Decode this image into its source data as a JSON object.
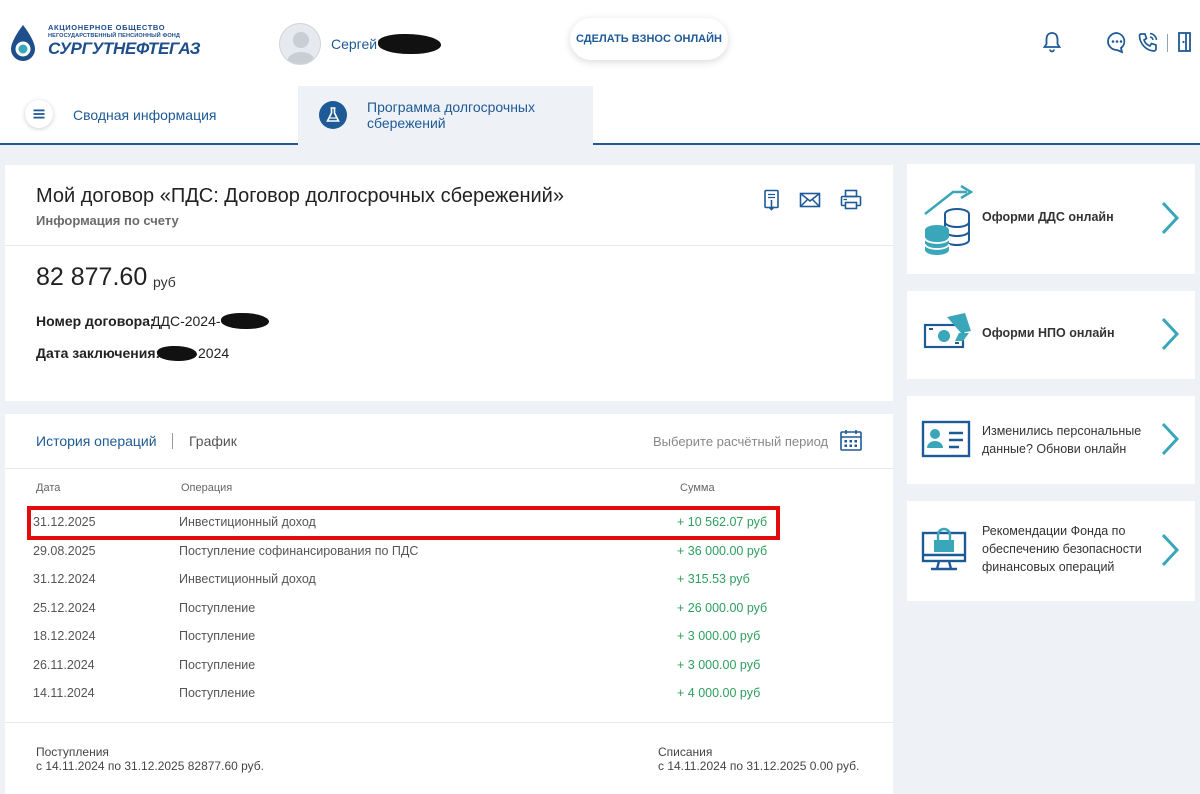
{
  "header": {
    "logo": {
      "line1": "АКЦИОНЕРНОЕ ОБЩЕСТВО",
      "line2": "НЕГОСУДАРСТВЕННЫЙ ПЕНСИОННЫЙ ФОНД",
      "line3": "СУРГУТНЕФТЕГАЗ"
    },
    "user_name": "Сергей",
    "contribute_button": "СДЕЛАТЬ ВЗНОС ОНЛАЙН",
    "icons": [
      "bell-icon",
      "chat-icon",
      "phone-icon",
      "logout-icon"
    ]
  },
  "tabs": [
    {
      "label": "Сводная информация",
      "icon": "menu-icon"
    },
    {
      "label": "Программа долгосрочных сбережений",
      "icon": "flask-icon",
      "active": true
    }
  ],
  "contract": {
    "title": "Мой договор «ПДС: Договор долгосрочных сбережений»",
    "subtitle": "Информация по счету",
    "actions": [
      "document-download-icon",
      "mail-icon",
      "printer-icon"
    ],
    "balance": "82 877.60",
    "balance_unit": "руб",
    "number_label": "Номер договора:",
    "number_value": "ДДС-2024-",
    "date_label": "Дата заключения:",
    "date_value": "2024"
  },
  "history": {
    "tab_active": "История операций",
    "tab_other": "График",
    "period_label": "Выберите расчётный период",
    "columns": [
      "Дата",
      "Операция",
      "Сумма"
    ],
    "rows": [
      {
        "date": "31.12.2025",
        "operation": "Инвестиционный доход",
        "amount": "+ 10 562.07 руб",
        "highlighted": true
      },
      {
        "date": "29.08.2025",
        "operation": "Поступление софинансирования по ПДС",
        "amount": "+ 36 000.00 руб"
      },
      {
        "date": "31.12.2024",
        "operation": "Инвестиционный доход",
        "amount": "+ 315.53 руб"
      },
      {
        "date": "25.12.2024",
        "operation": "Поступление",
        "amount": "+ 26 000.00 руб"
      },
      {
        "date": "18.12.2024",
        "operation": "Поступление",
        "amount": "+ 3 000.00 руб"
      },
      {
        "date": "26.11.2024",
        "operation": "Поступление",
        "amount": "+ 3 000.00 руб"
      },
      {
        "date": "14.11.2024",
        "operation": "Поступление",
        "amount": "+ 4 000.00 руб"
      }
    ],
    "footer": {
      "income_title": "Поступления",
      "income_text": "с 14.11.2024 по 31.12.2025 82877.60 руб.",
      "expense_title": "Списания",
      "expense_text": "с 14.11.2024 по 31.12.2025 0.00 руб."
    }
  },
  "promos": [
    {
      "text": "Оформи ДДС онлайн",
      "bold": true,
      "icon": "coins-growth-icon"
    },
    {
      "text": "Оформи НПО онлайн",
      "bold": true,
      "icon": "money-hand-icon"
    },
    {
      "text": "Изменились персональные данные? Обнови онлайн",
      "bold": false,
      "icon": "id-card-icon"
    },
    {
      "text": "Рекомендации Фонда по обеспечению безопасности финансовых операций",
      "bold": false,
      "icon": "computer-lock-icon"
    }
  ],
  "colors": {
    "brand_blue": "#1e5a96",
    "accent_teal": "#3aa6b9",
    "income_green": "#2e9e5e",
    "highlight_red": "#e10d0d"
  }
}
